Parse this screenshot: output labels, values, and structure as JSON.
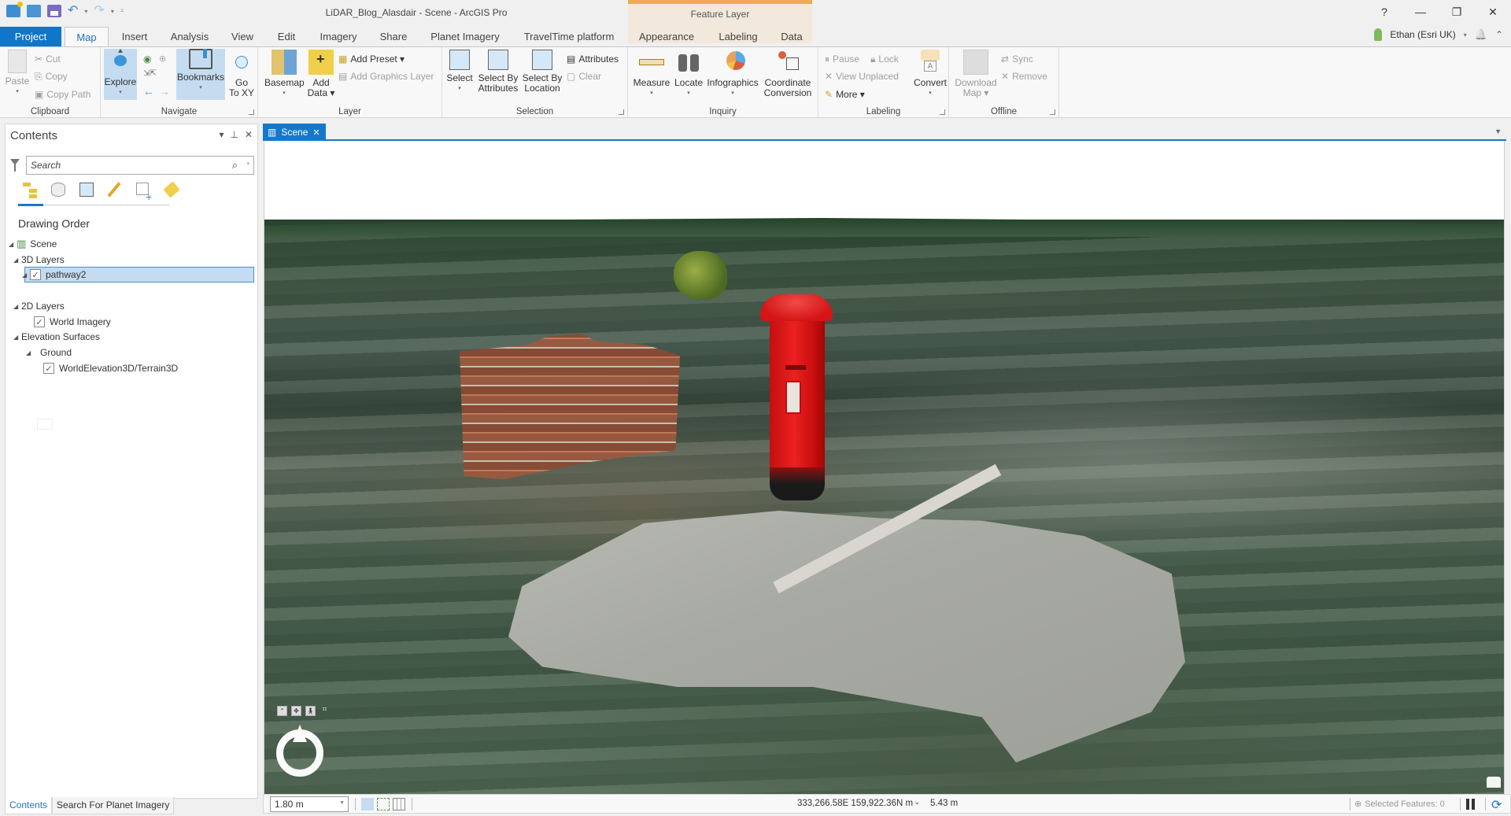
{
  "window": {
    "title": "LiDAR_Blog_Alasdair - Scene - ArcGIS Pro",
    "context_header": "Feature Layer",
    "controls": {
      "help": "?",
      "minimize": "—",
      "restore": "❐",
      "close": "✕"
    },
    "qat": {
      "undo": "↶",
      "redo": "↷",
      "caret": "▾",
      "customize": "⩡"
    }
  },
  "ribbon_tabs": [
    {
      "label": "Project"
    },
    {
      "label": "Map"
    },
    {
      "label": "Insert"
    },
    {
      "label": "Analysis"
    },
    {
      "label": "View"
    },
    {
      "label": "Edit"
    },
    {
      "label": "Imagery"
    },
    {
      "label": "Share"
    },
    {
      "label": "Planet Imagery"
    },
    {
      "label": "TravelTime platform"
    },
    {
      "label": "Appearance"
    },
    {
      "label": "Labeling"
    },
    {
      "label": "Data"
    }
  ],
  "user": {
    "name": "Ethan (Esri UK)",
    "caret": "▾",
    "bell": "🔔",
    "collapse": "⌃"
  },
  "ribbon": {
    "clipboard": {
      "label": "Clipboard",
      "paste": "Paste",
      "cut": "Cut",
      "copy": "Copy",
      "copy_path": "Copy Path"
    },
    "navigate": {
      "label": "Navigate",
      "explore": "Explore",
      "bookmarks": "Bookmarks",
      "go_to_xy_1": "Go",
      "go_to_xy_2": "To XY"
    },
    "layer": {
      "label": "Layer",
      "basemap": "Basemap",
      "add_data_1": "Add",
      "add_data_2": "Data ▾",
      "add_preset": "Add Preset ▾",
      "add_graphics_layer": "Add Graphics Layer"
    },
    "selection": {
      "label": "Selection",
      "select": "Select",
      "select_by_attributes_1": "Select By",
      "select_by_attributes_2": "Attributes",
      "select_by_location_1": "Select By",
      "select_by_location_2": "Location",
      "attributes": "Attributes",
      "clear": "Clear"
    },
    "inquiry": {
      "label": "Inquiry",
      "measure": "Measure",
      "locate": "Locate",
      "infographics": "Infographics",
      "coordinate_conversion_1": "Coordinate",
      "coordinate_conversion_2": "Conversion"
    },
    "labeling": {
      "label": "Labeling",
      "pause": "Pause",
      "lock": "Lock",
      "view_unplaced": "View Unplaced",
      "more": "More ▾",
      "convert": "Convert"
    },
    "offline": {
      "label": "Offline",
      "download_map_1": "Download",
      "download_map_2": "Map ▾",
      "sync": "Sync",
      "remove": "Remove"
    }
  },
  "contents": {
    "title": "Contents",
    "search_placeholder": "Search",
    "heading": "Drawing Order",
    "tree": {
      "scene": "Scene",
      "layers_3d": "3D Layers",
      "pathway": "pathway2",
      "layers_2d": "2D Layers",
      "world_imagery": "World Imagery",
      "elevation_surfaces": "Elevation Surfaces",
      "ground": "Ground",
      "terrain": "WorldElevation3D/Terrain3D"
    },
    "checks": {
      "pathway": true,
      "world_imagery": true,
      "terrain": true
    },
    "bottom_tabs": [
      {
        "label": "Contents"
      },
      {
        "label": "Search For Planet Imagery"
      }
    ]
  },
  "view": {
    "tab_label": "Scene",
    "close_glyph": "✕"
  },
  "status": {
    "scale": "1.80 m",
    "coordinates": "333,266.58E 159,922.36N m",
    "elevation": "5.43 m",
    "selected_features": "Selected Features: 0"
  },
  "colors": {
    "accent": "#1479cc",
    "context_tab": "#f0a95a",
    "selection": "#c5dcf0"
  }
}
